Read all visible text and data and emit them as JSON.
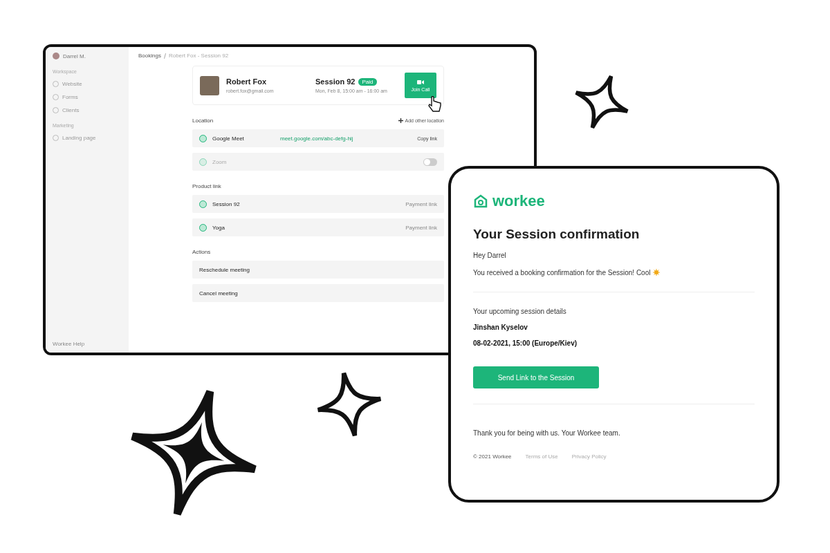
{
  "app_window": {
    "sidebar": {
      "user": "Darrel M.",
      "sections": [
        {
          "heading": "Workspace",
          "items": [
            {
              "label": "Website",
              "selected": false
            },
            {
              "label": "Forms",
              "selected": false
            },
            {
              "label": "Clients",
              "selected": false
            }
          ]
        },
        {
          "heading": "Marketing",
          "items": [
            {
              "label": "Landing page",
              "selected": false
            }
          ]
        }
      ],
      "footer": "Workee Help"
    },
    "breadcrumb": [
      "Bookings",
      "Robert Fox - Session 92"
    ],
    "booking": {
      "client_name": "Robert Fox",
      "client_email": "robert.fox@gmail.com",
      "session": "Session 92",
      "badge": "Paid",
      "time": "Mon, Feb 8, 15:00 am - 16:00 am",
      "join_button": "Join Call"
    },
    "location_heading": "Location",
    "add_location": "Add other location",
    "locations": [
      {
        "name": "Google Meet",
        "link": "meet.google.com/abc-defg-hij",
        "action": "Copy link",
        "on": true
      },
      {
        "name": "Zoom",
        "on": false
      }
    ],
    "products_heading": "Product link",
    "products": [
      {
        "name": "Session 92",
        "note": "Payment link"
      },
      {
        "name": "Yoga",
        "note": "Payment link"
      }
    ],
    "actions_heading": "Actions",
    "actions": [
      "Reschedule meeting",
      "Cancel meeting"
    ]
  },
  "email": {
    "brand": "workee",
    "title": "Your Session confirmation",
    "greeting": "Hey Darrel",
    "intro": "You received a booking confirmation for the Session! Cool",
    "details_heading": "Your upcoming session details",
    "person": "Jinshan Kyselov",
    "datetime": "08-02-2021, 15:00 (Europe/Kiev)",
    "button": "Send Link to the Session",
    "thanks": "Thank you for being with us. Your Workee team.",
    "footer_links": [
      "© 2021 Workee",
      "Terms of Use",
      "Privacy Policy"
    ]
  }
}
